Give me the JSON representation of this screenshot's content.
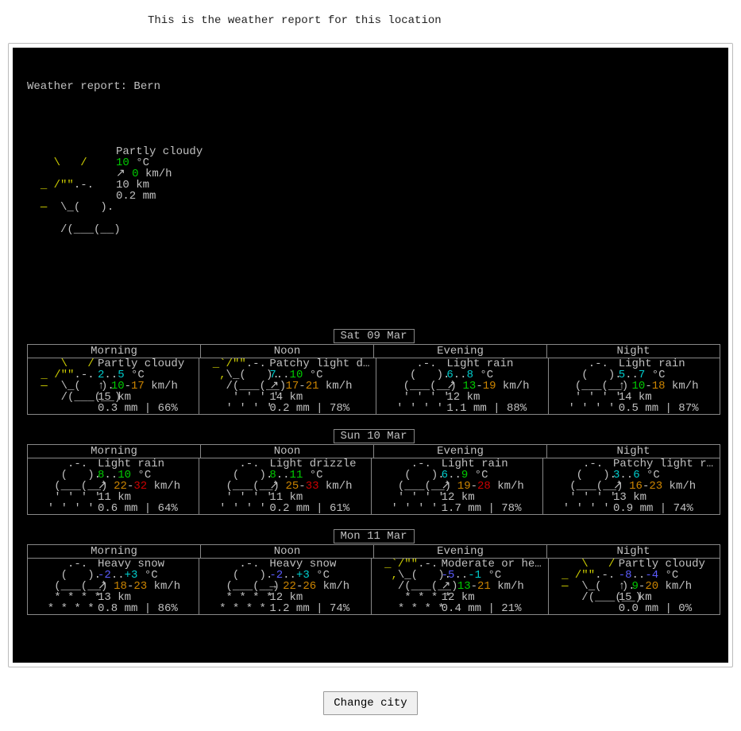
{
  "caption": "This is the weather report for this location",
  "report_header": "Weather report: Bern",
  "button_label": "Change city",
  "palette": {
    "background": "#000000",
    "text": "#c0c0c0",
    "yellow": "#cdcd00",
    "green": "#00cd00",
    "orange": "#cd8500",
    "red": "#cd0000",
    "cyan": "#00cdcd",
    "blue": "#5c5cff"
  },
  "current": {
    "icon": "partly-cloudy",
    "condition": "Partly cloudy",
    "temp_lo": 10,
    "temp_lo_color": "green",
    "temp_unit": "°C",
    "wind_arrow": "↗",
    "wind_speed": 0,
    "wind_speed_color": "green",
    "wind_unit": "km/h",
    "visibility": "10 km",
    "precip": "0.2 mm"
  },
  "ascii_icons": {
    "partly-cloudy": [
      {
        "pre": "    ",
        "sun": "\\   /",
        "post": ""
      },
      {
        "pre": "  _ ",
        "sun": "/\"\"",
        "post": ".-.    "
      },
      {
        "pre": "  ",
        "sun": "— ",
        "cloud": "\\_",
        "post": "(   ). "
      },
      {
        "pre": "    ",
        "cloud": "/(___(__)"
      },
      {
        "pre": "              "
      }
    ],
    "light-rain": [
      "      .-.    ",
      "     (   ).  ",
      "    (___(__) ",
      "    ' ' ' '  ",
      "   ' ' ' '   "
    ],
    "patchy-light-rain": [
      {
        "pre": "  _`",
        "sun": "/\"\"",
        "post": ".-.   "
      },
      {
        "pre": "   ",
        "sun": ",",
        "cloud": "\\_",
        "post": "(   ). "
      },
      {
        "pre": "    ",
        "cloud": "/(___(__)"
      },
      {
        "pre": "     ' ' ' ' "
      },
      {
        "pre": "    ' ' ' '  "
      }
    ],
    "snow": [
      "      .-.    ",
      "     (   ).  ",
      "    (___(__) ",
      "    * * * *  ",
      "   * * * *   "
    ]
  },
  "period_labels": [
    "Morning",
    "Noon",
    "Evening",
    "Night"
  ],
  "days": [
    {
      "title": "Sat 09 Mar",
      "periods": [
        {
          "icon": "partly-cloudy",
          "condition": "Partly cloudy",
          "t_lo": 2,
          "t_lo_c": "cyan",
          "t_hi": 5,
          "t_hi_c": "cyan",
          "wind_arrow": "↑",
          "w_lo": 10,
          "w_lo_c": "green",
          "w_hi": 17,
          "w_hi_c": "orange",
          "vis": "15 km",
          "precip": "0.3 mm | 66%"
        },
        {
          "icon": "patchy-light-rain",
          "condition": "Patchy light d…",
          "t_lo": 7,
          "t_lo_c": "cyan",
          "t_hi": 10,
          "t_hi_c": "green",
          "wind_arrow": "↗",
          "w_lo": 17,
          "w_lo_c": "orange",
          "w_hi": 21,
          "w_hi_c": "orange",
          "vis": "14 km",
          "precip": "0.2 mm | 78%"
        },
        {
          "icon": "light-rain",
          "condition": "Light rain",
          "t_lo": 6,
          "t_lo_c": "cyan",
          "t_hi": 8,
          "t_hi_c": "cyan",
          "wind_arrow": "↗",
          "w_lo": 13,
          "w_lo_c": "green",
          "w_hi": 19,
          "w_hi_c": "orange",
          "vis": "12 km",
          "precip": "1.1 mm | 88%"
        },
        {
          "icon": "light-rain",
          "condition": "Light rain",
          "t_lo": 5,
          "t_lo_c": "cyan",
          "t_hi": 7,
          "t_hi_c": "cyan",
          "wind_arrow": "↑",
          "w_lo": 10,
          "w_lo_c": "green",
          "w_hi": 18,
          "w_hi_c": "orange",
          "vis": "14 km",
          "precip": "0.5 mm | 87%"
        }
      ]
    },
    {
      "title": "Sun 10 Mar",
      "periods": [
        {
          "icon": "light-rain",
          "condition": "Light rain",
          "t_lo": 8,
          "t_lo_c": "green",
          "t_hi": 10,
          "t_hi_c": "green",
          "wind_arrow": "↗",
          "w_lo": 22,
          "w_lo_c": "orange",
          "w_hi": 32,
          "w_hi_c": "red",
          "vis": "11 km",
          "precip": "0.6 mm | 64%"
        },
        {
          "icon": "light-rain",
          "condition": "Light drizzle",
          "t_lo": 8,
          "t_lo_c": "green",
          "t_hi": 11,
          "t_hi_c": "green",
          "wind_arrow": "↗",
          "w_lo": 25,
          "w_lo_c": "orange",
          "w_hi": 33,
          "w_hi_c": "red",
          "vis": "11 km",
          "precip": "0.2 mm | 61%"
        },
        {
          "icon": "light-rain",
          "condition": "Light rain",
          "t_lo": 6,
          "t_lo_c": "cyan",
          "t_hi": 9,
          "t_hi_c": "green",
          "wind_arrow": "↗",
          "w_lo": 19,
          "w_lo_c": "orange",
          "w_hi": 28,
          "w_hi_c": "red",
          "vis": "12 km",
          "precip": "1.7 mm | 78%"
        },
        {
          "icon": "light-rain",
          "condition": "Patchy light r…",
          "t_lo": 3,
          "t_lo_c": "cyan",
          "t_hi": 6,
          "t_hi_c": "cyan",
          "wind_arrow": "↗",
          "w_lo": 16,
          "w_lo_c": "orange",
          "w_hi": 23,
          "w_hi_c": "orange",
          "vis": "13 km",
          "precip": "0.9 mm | 74%"
        }
      ]
    },
    {
      "title": "Mon 11 Mar",
      "periods": [
        {
          "icon": "snow",
          "condition": "Heavy snow",
          "t_lo": -2,
          "t_lo_c": "blue",
          "t_hi": "+3",
          "t_hi_c": "cyan",
          "wind_arrow": "↗",
          "w_lo": 18,
          "w_lo_c": "orange",
          "w_hi": 23,
          "w_hi_c": "orange",
          "vis": "13 km",
          "precip": "0.8 mm | 86%"
        },
        {
          "icon": "snow",
          "condition": "Heavy snow",
          "t_lo": -2,
          "t_lo_c": "blue",
          "t_hi": "+3",
          "t_hi_c": "cyan",
          "wind_arrow": "→",
          "w_lo": 22,
          "w_lo_c": "orange",
          "w_hi": 26,
          "w_hi_c": "orange",
          "vis": "12 km",
          "precip": "1.2 mm | 74%"
        },
        {
          "icon": "patchy-light-rain",
          "condition": "Moderate or he…",
          "t_lo": -5,
          "t_lo_c": "blue",
          "t_hi": -1,
          "t_hi_c": "cyan",
          "snowicon": true,
          "wind_arrow": "↗",
          "w_lo": 13,
          "w_lo_c": "green",
          "w_hi": 21,
          "w_hi_c": "orange",
          "vis": "12 km",
          "precip": "0.4 mm | 21%"
        },
        {
          "icon": "partly-cloudy",
          "condition": "Partly cloudy",
          "t_lo": -8,
          "t_lo_c": "blue",
          "t_hi": -4,
          "t_hi_c": "blue",
          "wind_arrow": "↑",
          "w_lo": 9,
          "w_lo_c": "green",
          "w_hi": 20,
          "w_hi_c": "orange",
          "vis": "15 km",
          "precip": "0.0 mm | 0%"
        }
      ]
    }
  ]
}
